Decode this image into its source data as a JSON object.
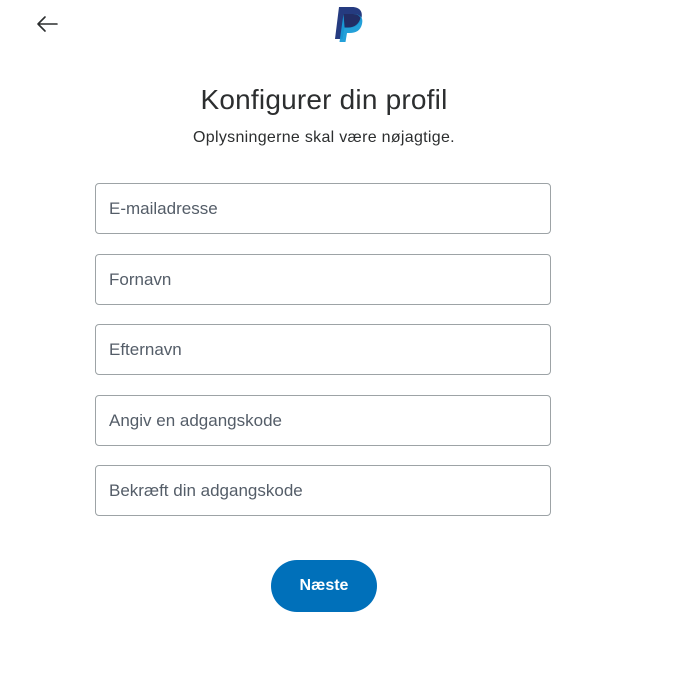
{
  "header": {
    "back_icon": "arrow-left-icon",
    "logo_icon": "paypal-logo-icon"
  },
  "main": {
    "title": "Konfigurer din profil",
    "subtitle": "Oplysningerne skal være nøjagtige."
  },
  "form": {
    "email": {
      "placeholder": "E-mailadresse",
      "value": ""
    },
    "first_name": {
      "placeholder": "Fornavn",
      "value": ""
    },
    "last_name": {
      "placeholder": "Efternavn",
      "value": ""
    },
    "password": {
      "placeholder": "Angiv en adgangskode",
      "value": ""
    },
    "confirm_password": {
      "placeholder": "Bekræft din adgangskode",
      "value": ""
    },
    "next_label": "Næste"
  },
  "colors": {
    "primary_button": "#0070ba",
    "logo_dark": "#253b80",
    "logo_light": "#179bd7",
    "text": "#2c2e2f",
    "field_border": "#9da3a6"
  }
}
